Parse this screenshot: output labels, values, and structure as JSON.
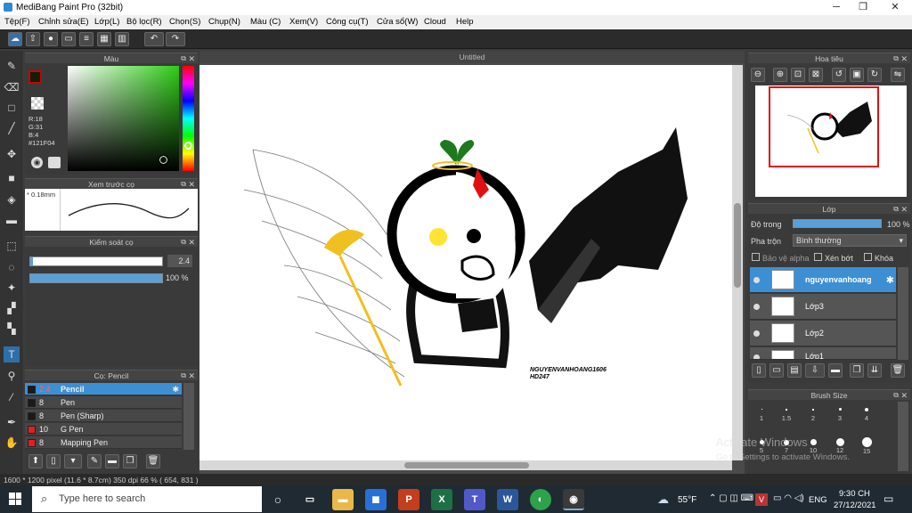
{
  "window": {
    "title": "MediBang Paint Pro (32bit)"
  },
  "menu": [
    "Tệp(F)",
    "Chỉnh sửa(E)",
    "Lớp(L)",
    "Bộ lọc(R)",
    "Chọn(S)",
    "Chụp(N)",
    "Màu (C)",
    "Xem(V)",
    "Công cụ(T)",
    "Cửa sổ(W)",
    "Cloud",
    "Help"
  ],
  "color_panel": {
    "title": "Màu",
    "r": "R:18",
    "g": "G:31",
    "b": "B:4",
    "hex": "#121F04",
    "fg_color": "#121F04"
  },
  "preview_panel": {
    "title": "Xem trước cọ",
    "size": "0.18mm"
  },
  "brush_control": {
    "title": "Kiểm soát cọ",
    "size": "2.4",
    "opacity": "100 %"
  },
  "brush_panel": {
    "title": "Cọ: Pencil",
    "items": [
      {
        "size": "2.4",
        "name": "Pencil",
        "color": "#1a1a1a"
      },
      {
        "size": "8",
        "name": "Pen",
        "color": "#1a1a1a"
      },
      {
        "size": "8",
        "name": "Pen (Sharp)",
        "color": "#1a1a1a"
      },
      {
        "size": "10",
        "name": "G Pen",
        "color": "#e02020"
      },
      {
        "size": "8",
        "name": "Mapping Pen",
        "color": "#e02020"
      }
    ]
  },
  "canvas": {
    "tab": "Untitled",
    "signature_line1": "NGUYENVANHOANG1606",
    "signature_line2": "HD247"
  },
  "navigator": {
    "title": "Hoa tiêu"
  },
  "layer_panel": {
    "title": "Lớp",
    "opacity_label": "Độ trong",
    "opacity_value": "100 %",
    "blend_label": "Pha trộn",
    "blend_value": "Bình thường",
    "protect_alpha": "Bảo vệ alpha",
    "clipping": "Xén bớt",
    "lock": "Khóa",
    "layers": [
      "nguyenvanhoang",
      "Lớp3",
      "Lớp2",
      "Lớp1"
    ]
  },
  "brush_size_panel": {
    "title": "Brush Size",
    "row1": [
      "1",
      "1.5",
      "2",
      "3",
      "4"
    ],
    "row2": [
      "5",
      "7",
      "10",
      "12",
      "15"
    ]
  },
  "activation": {
    "line1": "Activate Windows",
    "line2": "Go to Settings to activate Windows."
  },
  "status": {
    "text": "1600 * 1200 pixel   (11.6 * 8.7cm)   350 dpi   66 %   ( 654, 831 )"
  },
  "taskbar": {
    "search_placeholder": "Type here to search",
    "weather": "55°F",
    "lang": "ENG",
    "time": "9:30 CH",
    "date": "27/12/2021"
  }
}
